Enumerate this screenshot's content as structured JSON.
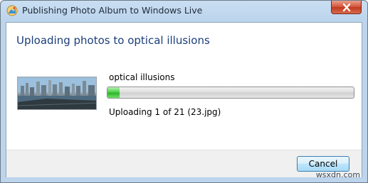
{
  "window": {
    "title": "Publishing Photo Album to Windows Live",
    "icon": "windows-live-photo-icon"
  },
  "dialog": {
    "heading": "Uploading photos to optical illusions",
    "album_name": "optical illusions",
    "status": "Uploading 1 of 21 (23.jpg)",
    "progress_fraction": 0.05,
    "cancel_label": "Cancel"
  },
  "watermark": "wsxdn.com",
  "colors": {
    "heading": "#1b3e7c",
    "progress_green": "#2fb42b",
    "close_red": "#c03a1f"
  }
}
